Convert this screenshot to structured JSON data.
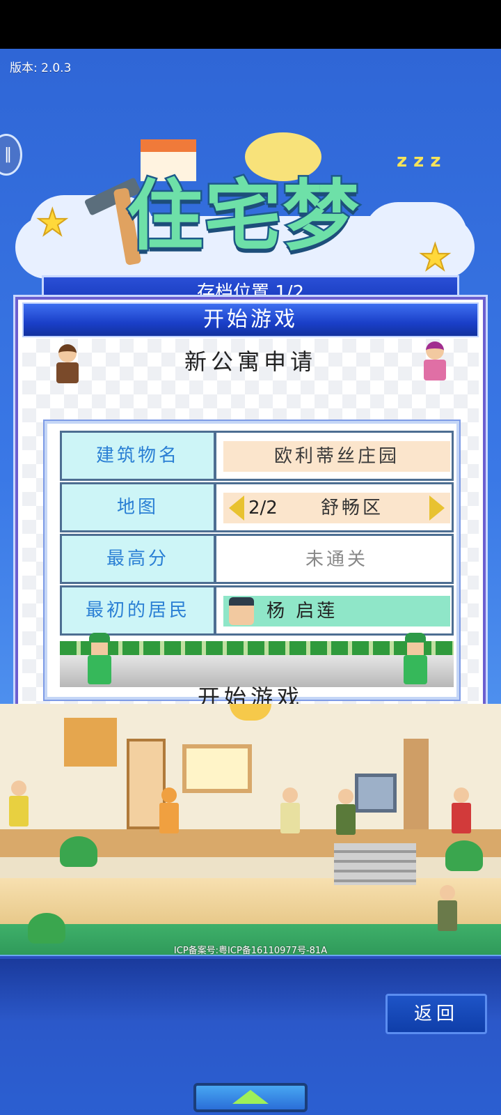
{
  "app": {
    "version_text": "版本: 2.0.3",
    "logo_text": "住宅梦"
  },
  "header_tab": {
    "title": "存档位置 1/2"
  },
  "dialog": {
    "title": "开始游戏",
    "subtitle": "新公寓申请",
    "fields": {
      "building_name": {
        "label": "建筑物名",
        "value": "欧利蒂丝庄园"
      },
      "map": {
        "label": "地图",
        "page": "2/2",
        "value": "舒畅区"
      },
      "high_score": {
        "label": "最高分",
        "value": "未通关"
      },
      "first_resident": {
        "label": "最初的居民",
        "value": "杨 启莲"
      }
    },
    "start_button_label": "开始游戏"
  },
  "footer": {
    "icp_text": "ICP备案号:粤ICP备16110977号-81A",
    "back_button_label": "返回"
  },
  "colors": {
    "dialog_header": "#1a3fc8",
    "key_cell": "#cdf5f7",
    "value_cell": "#fbe5cc",
    "resident_cell": "#8fe6c8",
    "label_text": "#2a7fd4",
    "accent_arrow": "#e8c230"
  },
  "icons": {
    "prev_map": "triangle-left-icon",
    "next_map": "triangle-right-icon",
    "expand": "triangle-up-icon",
    "side": "pause-icon"
  }
}
